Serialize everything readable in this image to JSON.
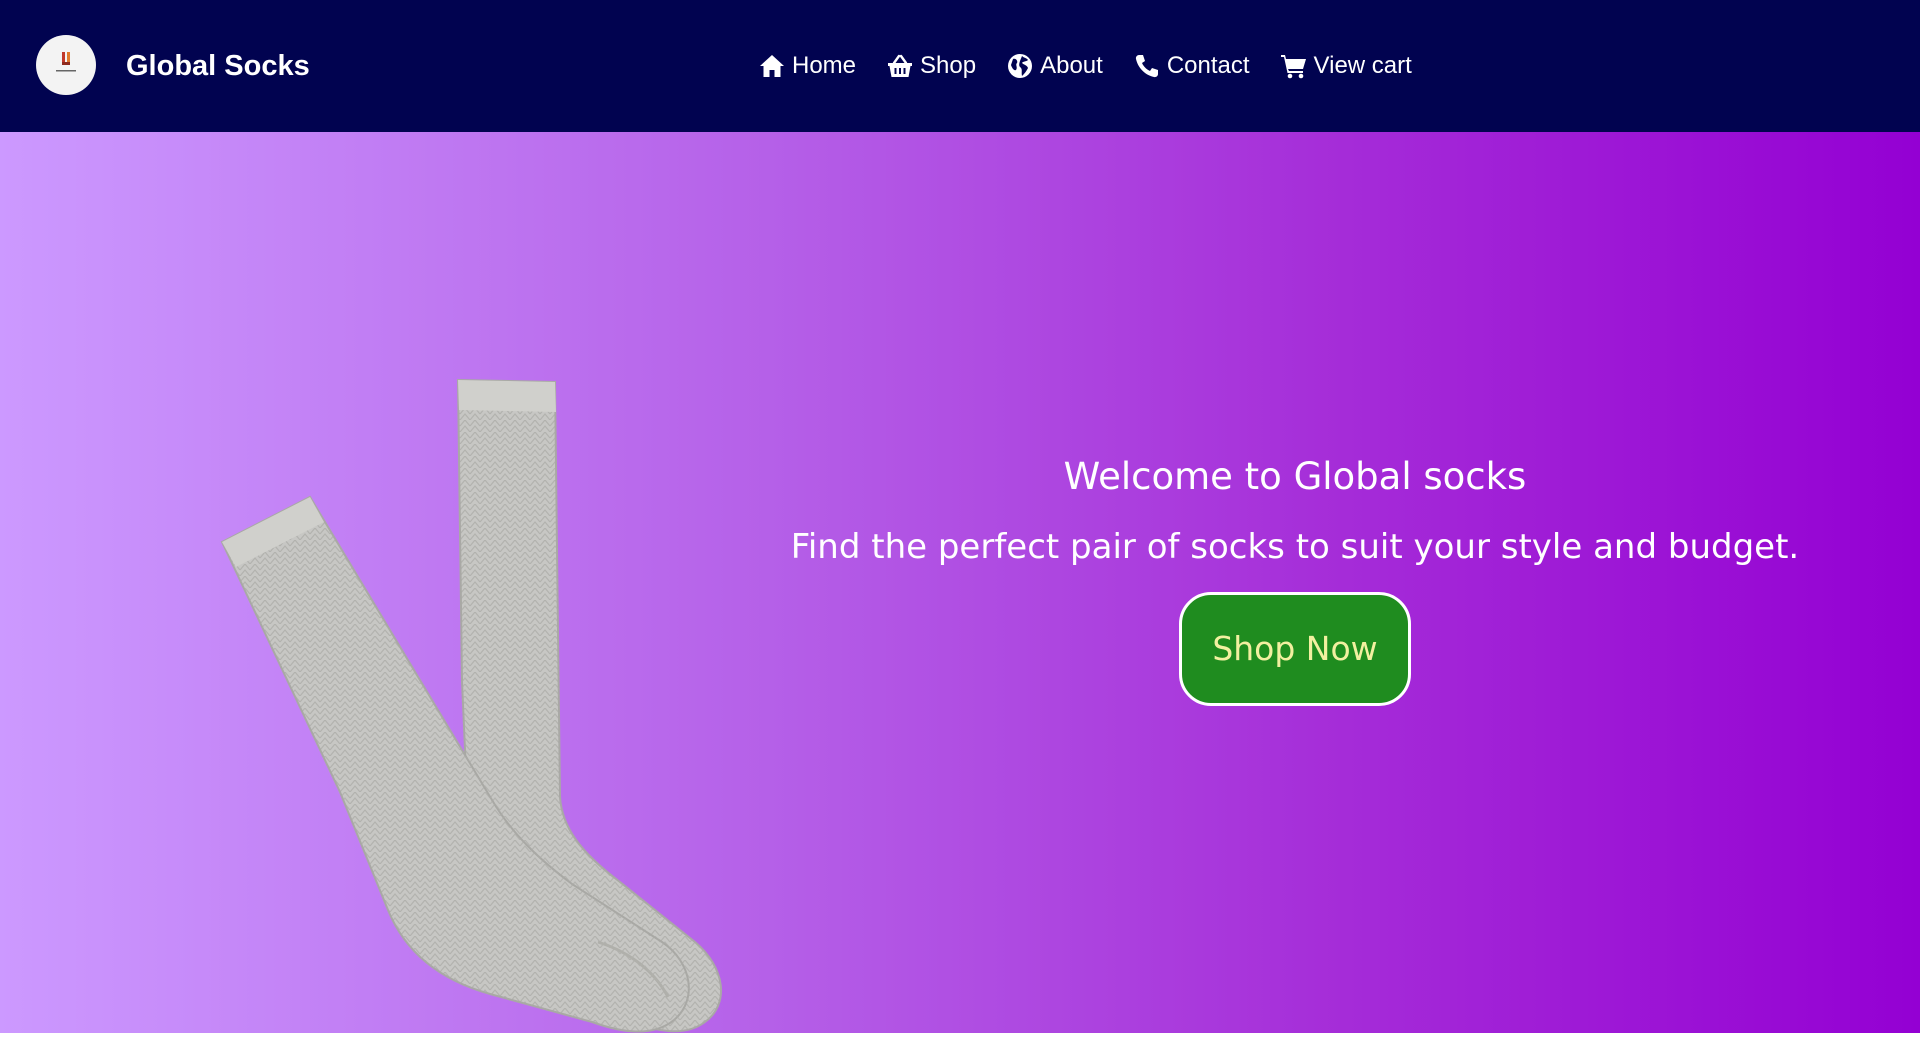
{
  "header": {
    "brand": "Global Socks",
    "logo_text": "Global Socks",
    "background_color": "#010350"
  },
  "nav": {
    "items": [
      {
        "label": "Home",
        "icon": "home-icon"
      },
      {
        "label": "Shop",
        "icon": "basket-icon"
      },
      {
        "label": "About",
        "icon": "globe-icon"
      },
      {
        "label": "Contact",
        "icon": "phone-icon"
      },
      {
        "label": "View cart",
        "icon": "cart-icon"
      }
    ]
  },
  "hero": {
    "title": "Welcome to Global socks",
    "subtitle": "Find the perfect pair of socks to suit your style and budget.",
    "cta_label": "Shop Now",
    "gradient_start": "#cc99ff",
    "gradient_end": "#9400d3",
    "cta_color": "#1f8c1f",
    "cta_text_color": "#f2f0a0"
  }
}
